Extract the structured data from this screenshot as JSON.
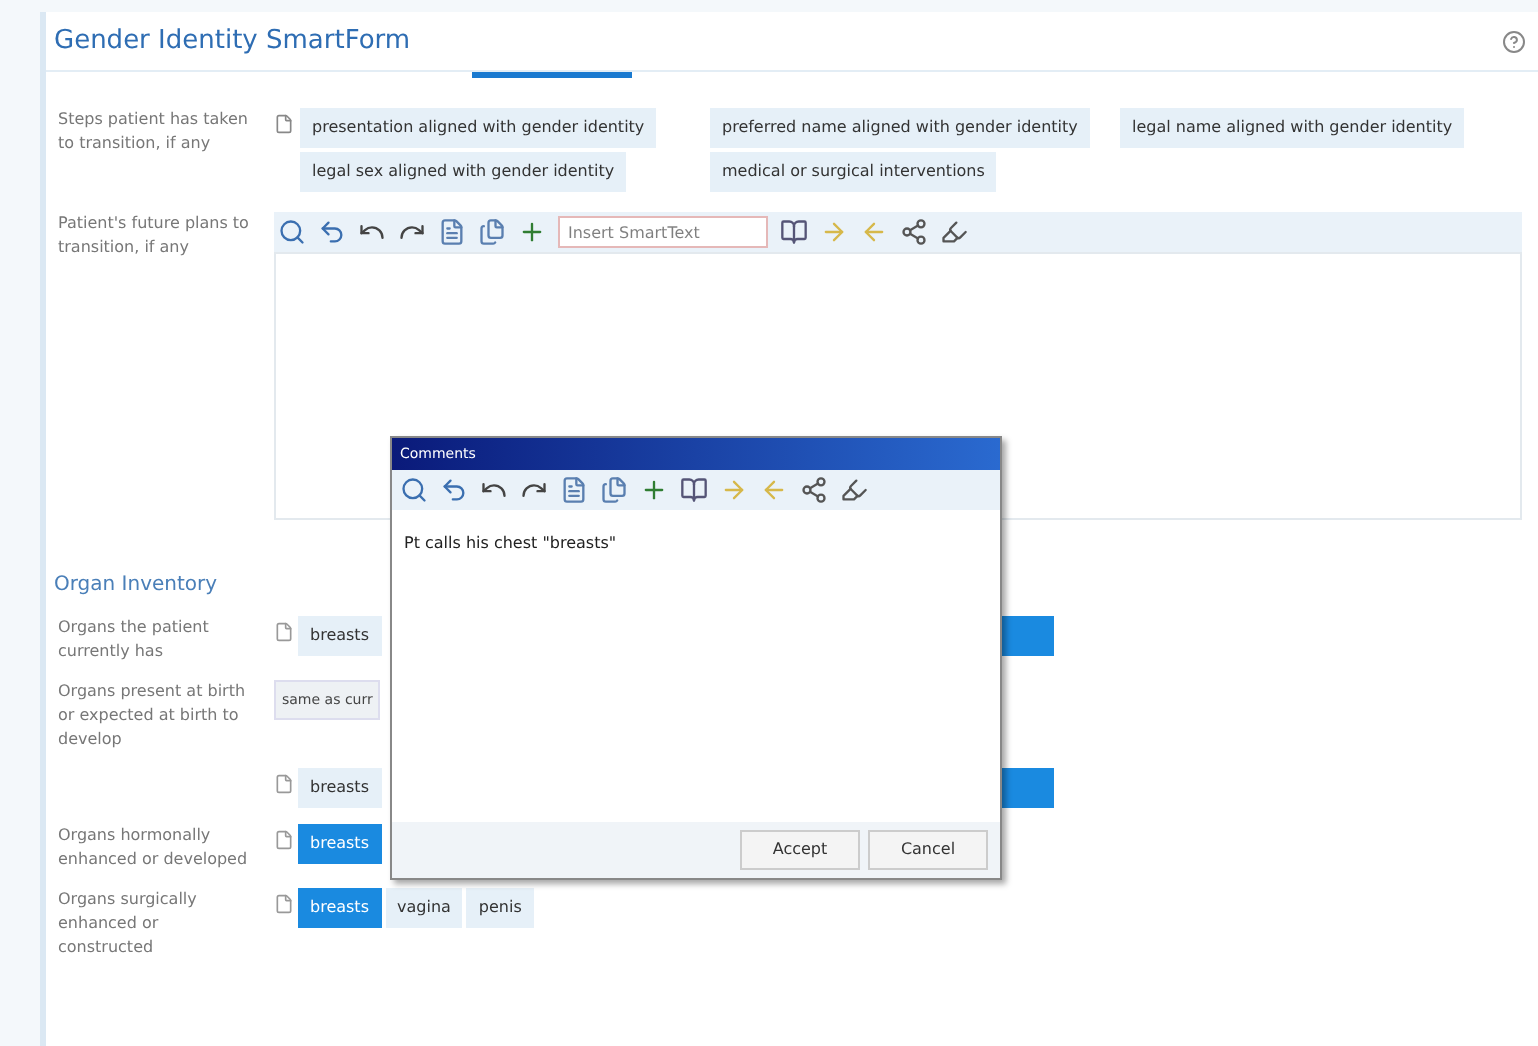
{
  "window": {
    "title": "Gender Identity SmartForm"
  },
  "steps": {
    "label": "Steps patient has taken to transition, if any",
    "options": [
      {
        "label": "presentation aligned with gender identity",
        "selected": false
      },
      {
        "label": "preferred name aligned with gender identity",
        "selected": false
      },
      {
        "label": "legal name aligned with gender identity",
        "selected": false
      },
      {
        "label": "legal sex aligned with gender identity",
        "selected": false
      },
      {
        "label": "medical or surgical interventions",
        "selected": false
      }
    ]
  },
  "future_plans": {
    "label": "Patient's future plans to transition, if any",
    "search": {
      "placeholder": "Insert SmartText"
    }
  },
  "organ_inventory": {
    "heading": "Organ Inventory",
    "rows": [
      {
        "label": "Organs the patient currently has",
        "kind": "chips",
        "options": [
          {
            "label": "breasts",
            "selected": false
          }
        ],
        "trailing_selected": true
      },
      {
        "label": "Organs present at birth or expected at birth to develop",
        "kind": "field",
        "value": "same as curr"
      },
      {
        "label": "",
        "kind": "chips",
        "options": [
          {
            "label": "breasts",
            "selected": false
          }
        ],
        "trailing_selected": true
      },
      {
        "label": "Organs hormonally enhanced or developed",
        "kind": "chips",
        "options": [
          {
            "label": "breasts",
            "selected": true
          }
        ],
        "trailing_selected": false
      },
      {
        "label": "Organs surgically enhanced or constructed",
        "kind": "chips",
        "options": [
          {
            "label": "breasts",
            "selected": true
          },
          {
            "label": "vagina",
            "selected": false
          },
          {
            "label": "penis",
            "selected": false
          }
        ],
        "trailing_selected": false
      }
    ]
  },
  "dialog": {
    "title": "Comments",
    "text": "Pt calls his chest \"breasts\"",
    "buttons": [
      "Accept",
      "Cancel"
    ]
  }
}
